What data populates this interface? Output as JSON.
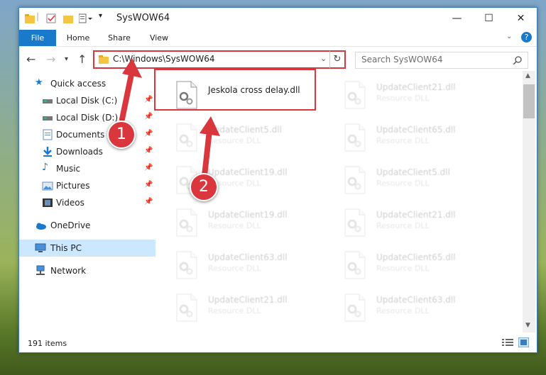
{
  "window": {
    "title": "SysWOW64"
  },
  "ribbon": {
    "tabs": [
      "File",
      "Home",
      "Share",
      "View"
    ]
  },
  "address": {
    "path": "C:\\Windows\\SysWOW64",
    "search_placeholder": "Search SysWOW64"
  },
  "sidebar": {
    "items": [
      {
        "label": "Quick access",
        "icon": "star-icon"
      },
      {
        "label": "Local Disk (C:)",
        "icon": "drive-icon",
        "pinned": true
      },
      {
        "label": "Local Disk (D:)",
        "icon": "drive-icon",
        "pinned": true
      },
      {
        "label": "Documents",
        "icon": "documents-icon",
        "pinned": true
      },
      {
        "label": "Downloads",
        "icon": "download-icon",
        "pinned": true
      },
      {
        "label": "Music",
        "icon": "music-icon",
        "pinned": true
      },
      {
        "label": "Pictures",
        "icon": "pictures-icon",
        "pinned": true
      },
      {
        "label": "Videos",
        "icon": "videos-icon",
        "pinned": true
      },
      {
        "label": "OneDrive",
        "icon": "cloud-icon"
      },
      {
        "label": "This PC",
        "icon": "computer-icon",
        "selected": true
      },
      {
        "label": "Network",
        "icon": "network-icon"
      }
    ]
  },
  "files": {
    "highlighted": {
      "name": "Jeskola cross delay.dll"
    },
    "left_column": [
      {
        "name": "UpdateClient5.dll",
        "type": "Resource DLL"
      },
      {
        "name": "UpdateClient19.dll",
        "type": "Resource DLL"
      },
      {
        "name": "UpdateClient19.dll",
        "type": "Resource DLL"
      },
      {
        "name": "UpdateClient63.dll",
        "type": "Resource DLL"
      },
      {
        "name": "UpdateClient21.dll",
        "type": "Resource DLL"
      }
    ],
    "right_column": [
      {
        "name": "UpdateClient21.dll",
        "type": "Resource DLL"
      },
      {
        "name": "UpdateClient65.dll",
        "type": "Resource DLL"
      },
      {
        "name": "UpdateClient5.dll",
        "type": "Resource DLL"
      },
      {
        "name": "UpdateClient21.dll",
        "type": "Resource DLL"
      },
      {
        "name": "UpdateClient65.dll",
        "type": "Resource DLL"
      },
      {
        "name": "UpdateClient63.dll",
        "type": "Resource DLL"
      }
    ]
  },
  "status": {
    "item_count": "191 items"
  },
  "annotations": {
    "step1": "1",
    "step2": "2"
  },
  "colors": {
    "accent": "#1979ca",
    "highlight": "#d9363e",
    "selected": "#cce8ff"
  }
}
